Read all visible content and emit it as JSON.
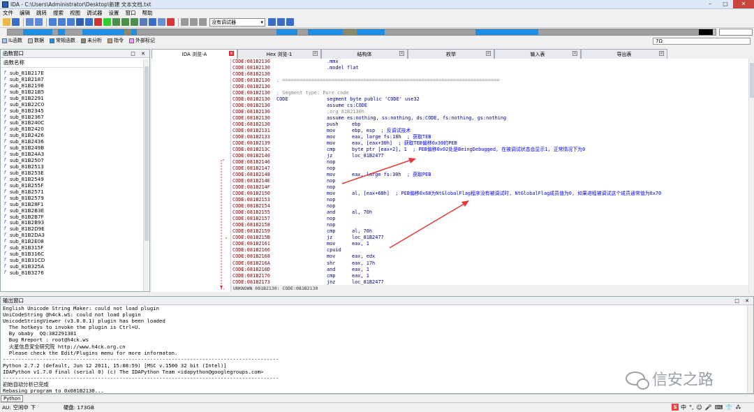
{
  "window": {
    "title": "IDA - C:\\Users\\Administrator\\Desktop\\新建 文本文档.txt",
    "controls": [
      "–",
      "□",
      "✕"
    ]
  },
  "menu": [
    "文件",
    "编辑",
    "跳转",
    "搜索",
    "视图",
    "调试器",
    "设置",
    "窗口",
    "帮助"
  ],
  "toolbar": {
    "debugger_select": "没有调试器"
  },
  "legend": [
    {
      "label": "IL函数",
      "color": "#a0c8f0"
    },
    {
      "label": "数据",
      "color": "#c0c0c0"
    },
    {
      "label": "常规函数",
      "color": "#1d8fe6"
    },
    {
      "label": "未分析",
      "color": "#8a8a6a"
    },
    {
      "label": "指令",
      "color": "#c79a6a"
    },
    {
      "label": "外部标记",
      "color": "#f0a0f0"
    }
  ],
  "address_box": "7Ω",
  "functions_panel": {
    "title": "函数窗口",
    "column_header": "函数名称",
    "items": [
      "sub_81B217E",
      "sub_81B2187",
      "sub_81B2198",
      "sub_81B21B5",
      "sub_81B2291",
      "sub_81B22C0",
      "sub_81B2345",
      "sub_81B2367",
      "sub_81B240C",
      "sub_81B2420",
      "sub_81B2426",
      "sub_81B2436",
      "sub_81B249B",
      "sub_81B24A3",
      "sub_81B2507",
      "sub_81B2513",
      "sub_81B253E",
      "sub_81B2549",
      "sub_81B255F",
      "sub_81B2571",
      "sub_81B2579",
      "sub_81B28F1",
      "sub_81B2B3E",
      "sub_81B2B7F",
      "sub_81B2B93",
      "sub_81B2D9E",
      "sub_81B2DA3",
      "sub_81B2E08",
      "sub_81B315F",
      "sub_81B316C",
      "sub_81B31CD",
      "sub_81B325A",
      "sub_81B3276"
    ]
  },
  "tabs": [
    {
      "label": "IDA 浏览-A",
      "active": true
    },
    {
      "label": "Hex 浏览-1",
      "active": false
    },
    {
      "label": "结构体",
      "active": false
    },
    {
      "label": "枚举",
      "active": false
    },
    {
      "label": "输入表",
      "active": false
    },
    {
      "label": "导出表",
      "active": false
    }
  ],
  "code_lines": [
    {
      "addr": "CODE:081B2130",
      "label": "",
      "mnem": ".mmx",
      "ops": "",
      "comment": ""
    },
    {
      "addr": "CODE:081B2130",
      "label": "",
      "mnem": ".model flat",
      "ops": "",
      "comment": ""
    },
    {
      "addr": "CODE:081B2130",
      "label": "",
      "mnem": "",
      "ops": "",
      "comment": ""
    },
    {
      "addr": "CODE:081B2130",
      "label": "",
      "mnem": "",
      "ops": "",
      "comment": "",
      "gray": "; ==========================================================================="
    },
    {
      "addr": "CODE:081B2130",
      "label": "",
      "mnem": "",
      "ops": "",
      "comment": ""
    },
    {
      "addr": "CODE:081B2130",
      "label": "",
      "mnem": "",
      "ops": "",
      "comment": "",
      "gray": "; Segment type: Pure code"
    },
    {
      "addr": "CODE:081B2130",
      "label": "CODE",
      "mnem": "segment byte public 'CODE' use32",
      "ops": "",
      "comment": ""
    },
    {
      "addr": "CODE:081B2130",
      "label": "",
      "mnem": "assume cs:CODE",
      "ops": "",
      "comment": ""
    },
    {
      "addr": "CODE:081B2130",
      "label": "",
      "mnem": "",
      "ops": "",
      "comment": "",
      "gray2": ";org 81B2130h"
    },
    {
      "addr": "CODE:081B2130",
      "label": "",
      "mnem": "assume es:nothing, ss:nothing, ds:CODE, fs:nothing, gs:nothing",
      "ops": "",
      "comment": ""
    },
    {
      "addr": "CODE:081B2130",
      "label": "",
      "mnem": "push",
      "ops": "ebp",
      "comment": ""
    },
    {
      "addr": "CODE:081B2131",
      "label": "",
      "mnem": "mov",
      "ops": "ebp, esp",
      "comment": "; 反调试技术"
    },
    {
      "addr": "CODE:081B2133",
      "label": "",
      "mnem": "mov",
      "ops": "eax, large fs:18h",
      "comment": "; 获取TEB"
    },
    {
      "addr": "CODE:081B2139",
      "label": "",
      "mnem": "mov",
      "ops": "eax, [eax+30h]",
      "comment": "; 获取TEB偏移0x30的PEB"
    },
    {
      "addr": "CODE:081B213C",
      "label": "",
      "mnem": "cmp",
      "ops": "byte ptr [eax+2], 1",
      "comment": "; PEB偏移0x02处是BeingDebugged, 在被调试状态会显示1, 正常情况下为0"
    },
    {
      "addr": "CODE:081B2140",
      "label": "",
      "mnem": "jz",
      "ops": "loc_81B2477",
      "comment": ""
    },
    {
      "addr": "CODE:081B2146",
      "label": "",
      "mnem": "nop",
      "ops": "",
      "comment": ""
    },
    {
      "addr": "CODE:081B2147",
      "label": "",
      "mnem": "nop",
      "ops": "",
      "comment": ""
    },
    {
      "addr": "CODE:081B2148",
      "label": "",
      "mnem": "mov",
      "ops": "eax, large fs:30h",
      "comment": "; 获取PEB"
    },
    {
      "addr": "CODE:081B214E",
      "label": "",
      "mnem": "nop",
      "ops": "",
      "comment": ""
    },
    {
      "addr": "CODE:081B214F",
      "label": "",
      "mnem": "nop",
      "ops": "",
      "comment": ""
    },
    {
      "addr": "CODE:081B2150",
      "label": "",
      "mnem": "mov",
      "ops": "al, [eax+68h]",
      "comment": "; PEB偏移0x68为NtGlobalFlag程序没有被调试时, NtGlobalFlag成员值为0, 如果进程被调试这个成员通常值为0x70"
    },
    {
      "addr": "CODE:081B2153",
      "label": "",
      "mnem": "nop",
      "ops": "",
      "comment": ""
    },
    {
      "addr": "CODE:081B2154",
      "label": "",
      "mnem": "nop",
      "ops": "",
      "comment": ""
    },
    {
      "addr": "CODE:081B2155",
      "label": "",
      "mnem": "and",
      "ops": "al, 70h",
      "comment": ""
    },
    {
      "addr": "CODE:081B2157",
      "label": "",
      "mnem": "nop",
      "ops": "",
      "comment": ""
    },
    {
      "addr": "CODE:081B2158",
      "label": "",
      "mnem": "nop",
      "ops": "",
      "comment": ""
    },
    {
      "addr": "CODE:081B2159",
      "label": "",
      "mnem": "cmp",
      "ops": "al, 70h",
      "comment": ""
    },
    {
      "addr": "CODE:081B215B",
      "label": "",
      "mnem": "jz",
      "ops": "loc_81B2477",
      "comment": ""
    },
    {
      "addr": "CODE:081B2161",
      "label": "",
      "mnem": "mov",
      "ops": "eax, 1",
      "comment": ""
    },
    {
      "addr": "CODE:081B2166",
      "label": "",
      "mnem": "cpuid",
      "ops": "",
      "comment": ""
    },
    {
      "addr": "CODE:081B2168",
      "label": "",
      "mnem": "mov",
      "ops": "eax, edx",
      "comment": ""
    },
    {
      "addr": "CODE:081B216A",
      "label": "",
      "mnem": "shr",
      "ops": "eax, 17h",
      "comment": ""
    },
    {
      "addr": "CODE:081B216D",
      "label": "",
      "mnem": "and",
      "ops": "eax, 1",
      "comment": ""
    },
    {
      "addr": "CODE:081B2170",
      "label": "",
      "mnem": "cmp",
      "ops": "eax, 1",
      "comment": ""
    },
    {
      "addr": "CODE:081B2173",
      "label": "",
      "mnem": "jnz",
      "ops": "loc_81B2477",
      "comment": ""
    }
  ],
  "code_status": "UNKNOWN 081B2130: CODE:081B2130",
  "output_panel": {
    "title": "输出窗口",
    "lines": [
      "English Unicode String Maker: could not load plugin",
      "UniCodeString @h4ck.wS: could not load plugin",
      "UnicodeStringViewer (v3.0.0.1) plugin has been loaded",
      "  The hotkeys to invoke the plugin is Ctrl+U.",
      "  By obaby  QQ:382291381",
      "  Bug Rreport : root@h4ck.ws",
      "  火星信息安全研究院 http://www.h4ck.org.cn",
      "  Please check the Edit/Plugins menu for more informaton.",
      "------------------------------------------------------------------------------------------",
      "Python 2.7.2 (default, Jun 12 2011, 15:08:59) [MSC v.1500 32 bit (Intel)]",
      "IDAPython v1.7.0 final (serial 0) (c) The IDAPython Team <idapython@googlegroups.com>",
      "------------------------------------------------------------------------------------------",
      "初始自动分析已完成",
      "Rebasing program to 0x081B2130..."
    ]
  },
  "python_button": "Python",
  "statusbar": {
    "au": "AU:",
    "state": "空闲中",
    "dir": "下",
    "disk": "硬盘: 173GB"
  },
  "ime": {
    "logo": "S",
    "items": [
      "中",
      "°,",
      "☺",
      "🎤",
      "⌨",
      "👕",
      "⁂"
    ]
  },
  "watermark": "信安之路",
  "nav_band_colors": [
    "#a0a0a0",
    "#1d8fe6",
    "#a0a0a0",
    "#1d8fe6",
    "#a0a0a0",
    "#1d8fe6",
    "#8a8a6a",
    "#1d8fe6",
    "#a0a0a0",
    "#1d8fe6",
    "#a0a0a0",
    "#1d8fe6",
    "#8a8a6a",
    "#1d8fe6",
    "#a0a0a0",
    "#1d8fe6",
    "#a0a0a0",
    "#000000",
    "#c0c0c0"
  ]
}
